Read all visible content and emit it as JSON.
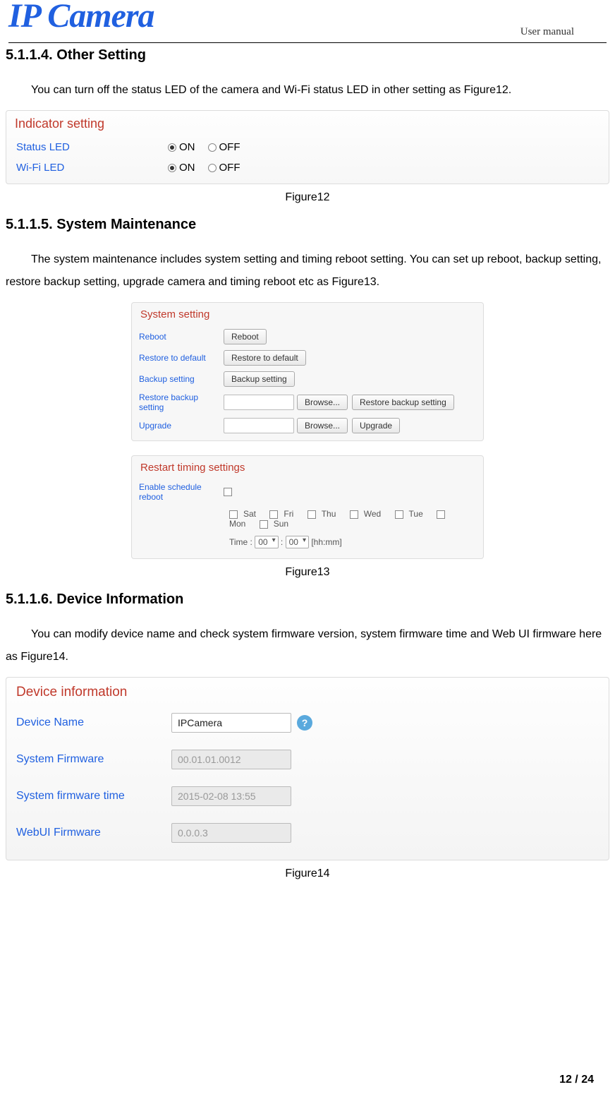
{
  "header": {
    "logo_text": "IP Camera",
    "top_right": "User manual"
  },
  "sec1": {
    "number": "5.1.1.4.",
    "title": "Other Setting",
    "body": "You can turn off the status LED of the camera and Wi-Fi status LED in other setting as Figure12."
  },
  "indicator": {
    "header": "Indicator setting",
    "rows": [
      {
        "label": "Status LED",
        "on": "ON",
        "off": "OFF",
        "selected": "on"
      },
      {
        "label": "Wi-Fi LED",
        "on": "ON",
        "off": "OFF",
        "selected": "on"
      }
    ],
    "caption": "Figure12"
  },
  "sec2": {
    "number": "5.1.1.5.",
    "title": "System Maintenance",
    "body": "The system maintenance includes system setting and timing reboot setting. You can set up reboot, backup setting, restore backup setting, upgrade camera and timing reboot etc as Figure13."
  },
  "sysset": {
    "header": "System setting",
    "reboot_label": "Reboot",
    "reboot_btn": "Reboot",
    "restore_label": "Restore to default",
    "restore_btn": "Restore to default",
    "backup_label": "Backup setting",
    "backup_btn": "Backup setting",
    "restorebk_label": "Restore backup setting",
    "browse_btn": "Browse...",
    "restorebk_btn": "Restore backup setting",
    "upgrade_label": "Upgrade",
    "upgrade_btn": "Upgrade"
  },
  "restart": {
    "header": "Restart timing settings",
    "enable_label": "Enable schedule reboot",
    "days": [
      "Sat",
      "Fri",
      "Thu",
      "Wed",
      "Tue",
      "Mon",
      "Sun"
    ],
    "time_label": "Time :",
    "hh": "00",
    "mm": "00",
    "hhmm": "[hh:mm]",
    "caption": "Figure13"
  },
  "sec3": {
    "number": "5.1.1.6.",
    "title": "Device Information",
    "body": "You can modify device name and check system firmware version, system firmware time and Web UI firmware here as Figure14."
  },
  "devinfo": {
    "header": "Device information",
    "name_label": "Device Name",
    "name_value": "IPCamera",
    "fw_label": "System Firmware",
    "fw_value": "00.01.01.0012",
    "fwtime_label": "System firmware time",
    "fwtime_value": "2015-02-08 13:55",
    "webui_label": "WebUI Firmware",
    "webui_value": "0.0.0.3",
    "caption": "Figure14"
  },
  "footer": {
    "page": "12 / 24"
  }
}
